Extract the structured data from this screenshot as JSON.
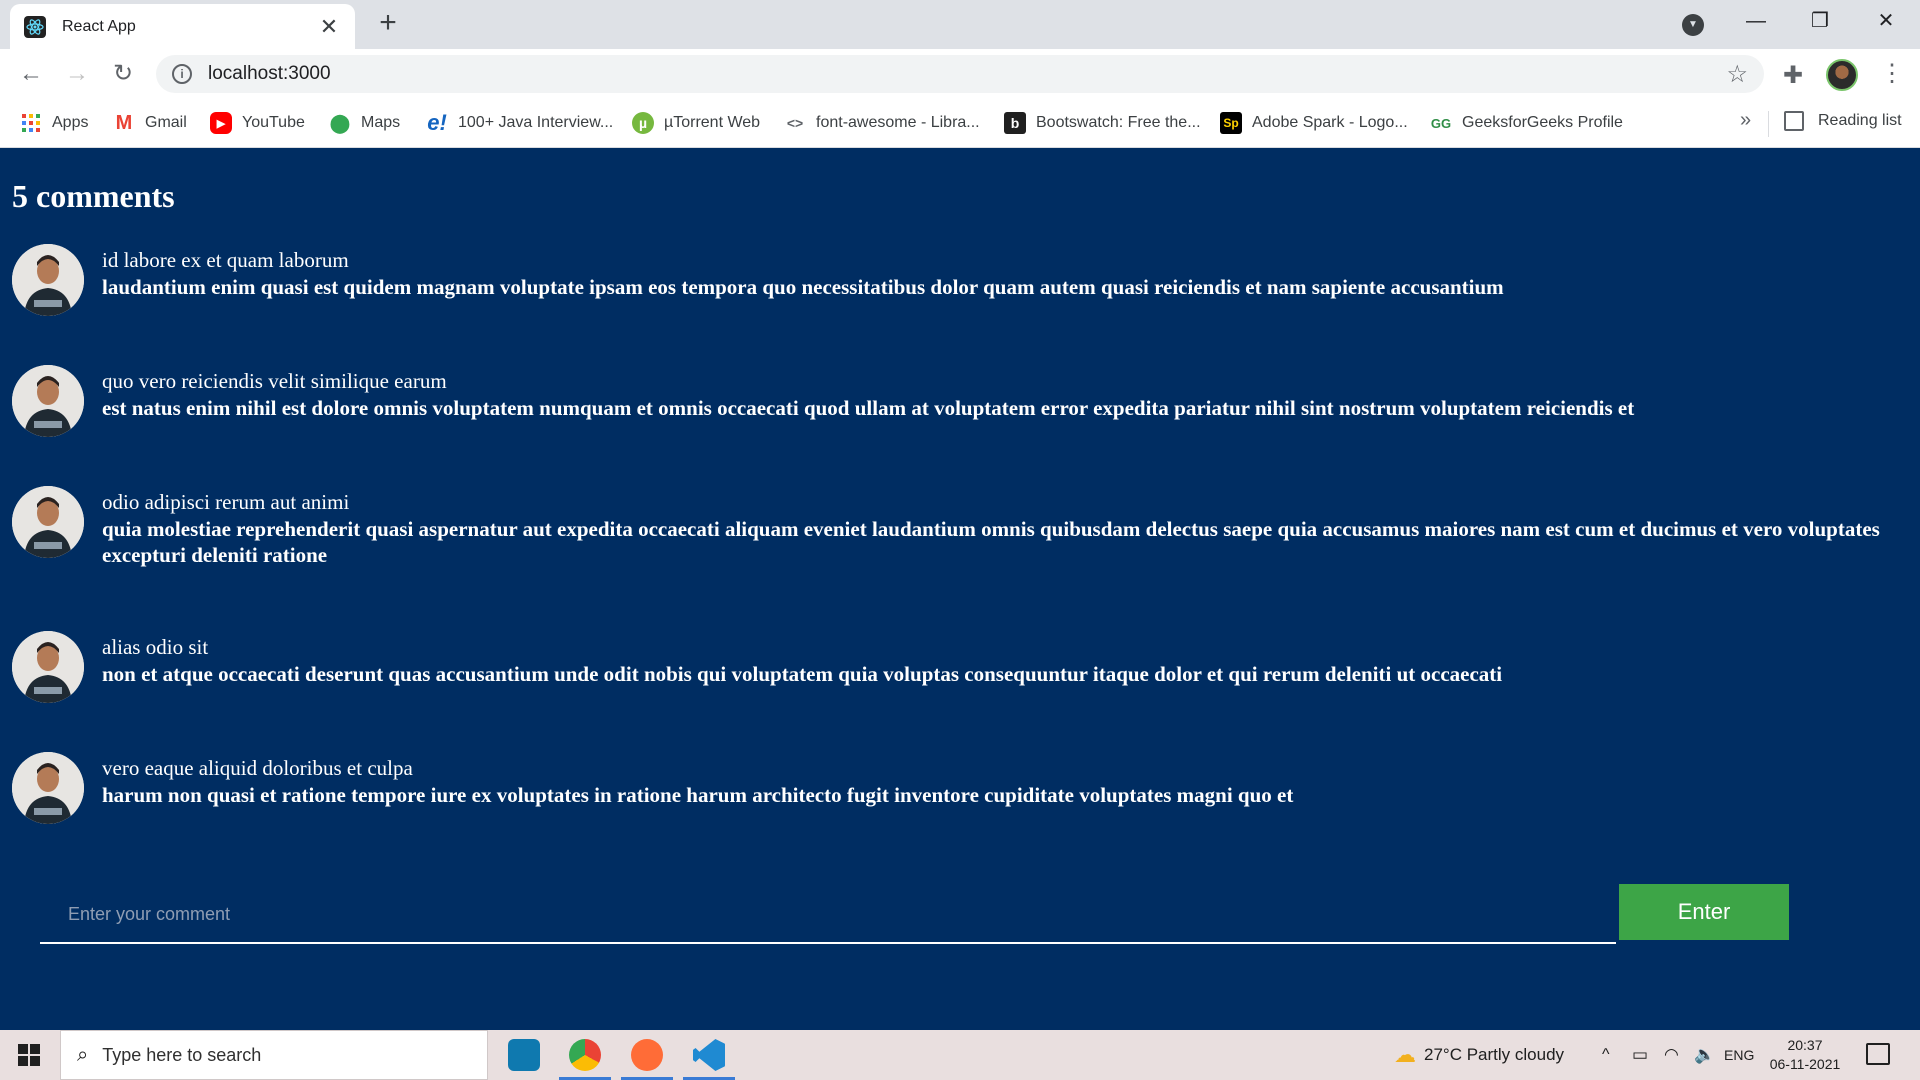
{
  "browser": {
    "tab_title": "React App",
    "tab_close": "✕",
    "new_tab": "+",
    "url": "localhost:3000",
    "bookmarks": [
      {
        "label": "Apps",
        "icon": "apps-grid-icon"
      },
      {
        "label": "Gmail",
        "icon": "gmail-icon"
      },
      {
        "label": "YouTube",
        "icon": "youtube-icon"
      },
      {
        "label": "Maps",
        "icon": "maps-pin-icon"
      },
      {
        "label": "100+ Java Interview...",
        "icon": "edureka-icon"
      },
      {
        "label": "µTorrent Web",
        "icon": "utorrent-icon"
      },
      {
        "label": "font-awesome - Libra...",
        "icon": "code-brackets-icon"
      },
      {
        "label": "Bootswatch: Free the...",
        "icon": "bootswatch-icon"
      },
      {
        "label": "Adobe Spark - Logo...",
        "icon": "adobe-spark-icon"
      },
      {
        "label": "GeeksforGeeks Profile",
        "icon": "geeksforgeeks-icon"
      }
    ],
    "bookmarks_more": "»",
    "reading_list": "Reading list"
  },
  "page": {
    "heading": "5 comments",
    "comments": [
      {
        "name": "id labore ex et quam laborum",
        "body": "laudantium enim quasi est quidem magnam voluptate ipsam eos tempora quo necessitatibus dolor quam autem quasi reiciendis et nam sapiente accusantium"
      },
      {
        "name": "quo vero reiciendis velit similique earum",
        "body": "est natus enim nihil est dolore omnis voluptatem numquam et omnis occaecati quod ullam at voluptatem error expedita pariatur nihil sint nostrum voluptatem reiciendis et"
      },
      {
        "name": "odio adipisci rerum aut animi",
        "body": "quia molestiae reprehenderit quasi aspernatur aut expedita occaecati aliquam eveniet laudantium omnis quibusdam delectus saepe quia accusamus maiores nam est cum et ducimus et vero voluptates excepturi deleniti ratione"
      },
      {
        "name": "alias odio sit",
        "body": "non et atque occaecati deserunt quas accusantium unde odit nobis qui voluptatem quia voluptas consequuntur itaque dolor et qui rerum deleniti ut occaecati"
      },
      {
        "name": "vero eaque aliquid doloribus et culpa",
        "body": "harum non quasi et ratione tempore iure ex voluptates in ratione harum architecto fugit inventore cupiditate voluptates magni quo et"
      }
    ],
    "input_placeholder": "Enter your comment",
    "input_value": "",
    "enter_label": "Enter",
    "colors": {
      "background": "#002d62",
      "button": "#3da547",
      "text": "#ffffff"
    }
  },
  "taskbar": {
    "search_placeholder": "Type here to search",
    "weather": "27°C  Partly cloudy",
    "language": "ENG",
    "time": "20:37",
    "date": "06-11-2021"
  }
}
